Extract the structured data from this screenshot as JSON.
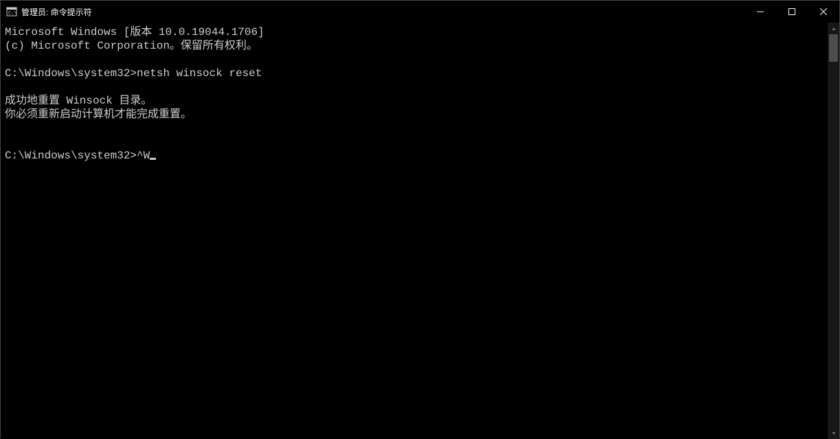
{
  "titlebar": {
    "title": "管理员: 命令提示符"
  },
  "terminal": {
    "line1": "Microsoft Windows [版本 10.0.19044.1706]",
    "line2": "(c) Microsoft Corporation。保留所有权利。",
    "blank1": "",
    "prompt1": "C:\\Windows\\system32>",
    "cmd1": "netsh winsock reset",
    "blank2": "",
    "out1": "成功地重置 Winsock 目录。",
    "out2": "你必须重新启动计算机才能完成重置。",
    "blank3": "",
    "blank4": "",
    "prompt2": "C:\\Windows\\system32>",
    "cmd2": "^W"
  }
}
